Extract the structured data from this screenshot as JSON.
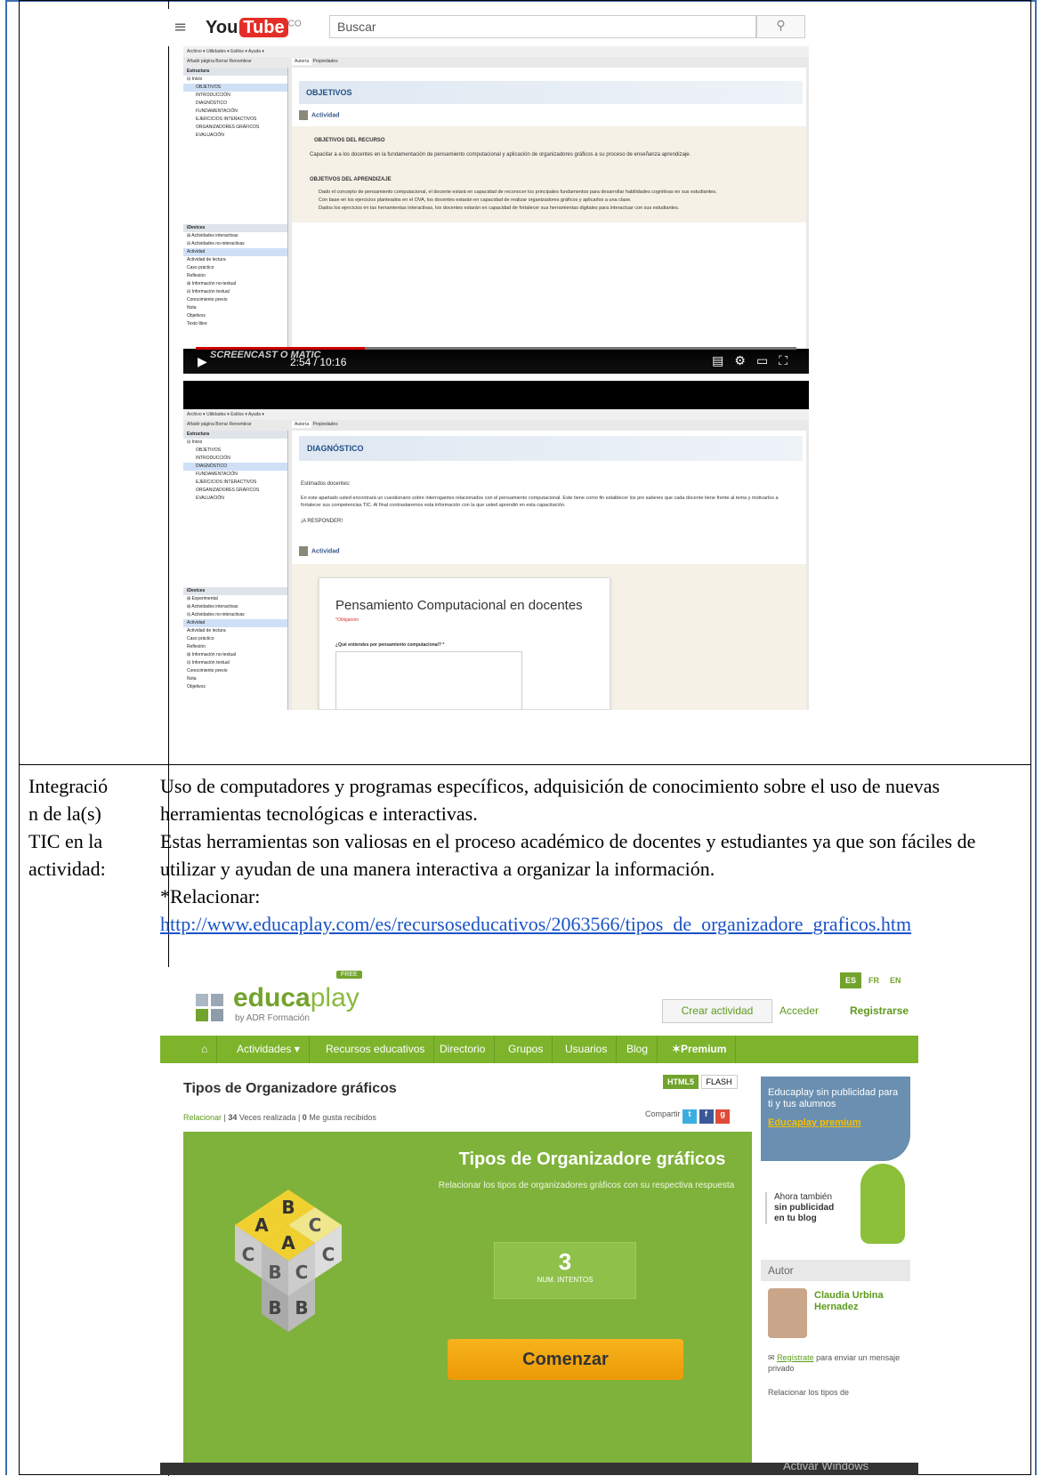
{
  "youtube": {
    "logo_you": "You",
    "logo_tube": "Tube",
    "logo_region": "CO",
    "search_placeholder": "Buscar",
    "time": "2:54 / 10:16",
    "watermark": "SCREENCAST O MATIC"
  },
  "video1": {
    "menu": "Archivo ▾  Utilidades ▾  Estilos ▾  Ayuda ▾",
    "toolbar": "Añadir página  Borrar  Renombrar",
    "tabs": [
      "Autoría",
      "Propiedades"
    ],
    "structure_header": "Estructura",
    "tree": [
      "⊟ Inicio",
      "OBJETIVOS",
      "INTRODUCCIÓN",
      "DIAGNÓSTICO",
      "FUNDAMENTACIÓN",
      "EJERCICIOS INTERACTIVOS",
      "ORGANIZADORES GRÁFICOS",
      "EVALUACIÓN"
    ],
    "idevices_header": "iDevices",
    "idevices": [
      "⊞ Actividades interactivas",
      "⊟ Actividades no-interactivas",
      "Actividad",
      "Actividad de lectura",
      "Caso práctico",
      "Reflexión",
      "⊞ Información no-textual",
      "⊟ Información textual",
      "Conocimiento previo",
      "Nota",
      "Objetivos",
      "Texto libre"
    ],
    "banner": "OBJETIVOS",
    "activity": "Actividad",
    "h1": "OBJETIVOS DEL RECURSO",
    "p1": "Capacitar a a los docentes en la fundamentación de pensamiento computacional y aplicación de organizadores gráficos a su proceso de enseñanza aprendizaje.",
    "h2": "OBJETIVOS DEL APRENDIZAJE",
    "bullets": [
      "Dado el concepto de pensamiento computacional, el docente estará en capacidad de reconocer los principales fundamentos para desarrollar habilidades cognitivas en sus estudiantes.",
      "Con base en los ejercicios planteados en el OVA, los docentes estarán en capacidad de realizar organizadores gráficos y aplicarlos a una clase.",
      "Dados los ejercicios en las herramientas interactivas, los docentes estarán en capacidad de fortalecer sus herramientas digitales para interactuar con sus estudiantes."
    ]
  },
  "video2": {
    "banner": "DIAGNÓSTICO",
    "greeting": "Estimados docentes:",
    "p1": "En este apartado usted encontrará un cuestionario sobre interrogantes relacionados con el pensamiento computacional. Este tiene como fin establecer los pre saberes que cada docente tiene frente al tema y motivarlos a fortalecer sus competencias TIC. Al final contrastaremos esta información con la que usted aprendió en esta capacitación.",
    "cta": "¡A RESPONDER!",
    "activity": "Actividad",
    "form_title": "Pensamiento Computacional en docentes",
    "form_required": "*Obligatorio",
    "form_question": "¿Qué entiendes por pensamiento computacional? *",
    "idevices": [
      "⊞ Experimental",
      "⊞ Actividades interactivas",
      "⊟ Actividades no-interactivas",
      "Actividad",
      "Actividad de lectura",
      "Caso práctico",
      "Reflexión",
      "⊞ Información no-textual",
      "⊟ Información textual",
      "Conocimiento previo",
      "Nota",
      "Objetivos"
    ]
  },
  "row2": {
    "label": "Integración de la(s) TIC en la actividad:",
    "label_lines": [
      "Integració",
      "n de la(s)",
      "TIC en la",
      "actividad:"
    ],
    "p1": "Uso de computadores y programas específicos, adquisición de conocimiento sobre el uso de nuevas herramientas tecnológicas e interactivas.",
    "p2": "Estas herramientas son valiosas en el proceso académico de docentes y estudiantes ya que son fáciles de utilizar y ayudan de una manera interactiva a organizar la información.",
    "p3": "*Relacionar:",
    "link": "http://www.educaplay.com/es/recursoseducativos/2063566/tipos_de_organizadore_graficos.htm"
  },
  "educaplay": {
    "brand_educa": "educa",
    "brand_play": "play",
    "free": "FREE",
    "by": "by ADR Formación",
    "langs": [
      "ES",
      "FR",
      "EN"
    ],
    "crear": "Crear actividad",
    "acceder": "Acceder",
    "registrarse": "Registrarse",
    "nav": [
      "Actividades ▾",
      "Recursos educativos",
      "Directorio",
      "Grupos",
      "Usuarios",
      "Blog",
      "✶Premium"
    ],
    "title": "Tipos de Organizadore gráficos",
    "tab_html5": "HTML5",
    "tab_flash": "FLASH",
    "meta_type": "Relacionar",
    "meta_count": "34",
    "meta_count_label": "Veces realizada",
    "meta_likes": "0",
    "meta_likes_label": "Me gusta recibidos",
    "share": "Compartir",
    "green_title": "Tipos de Organizadore gráficos",
    "green_sub": "Relacionar los tipos de organizadores gráficos con su respectiva respuesta",
    "attempts": "3",
    "attempts_label": "NUM. INTENTOS",
    "start": "Comenzar",
    "ad_text": "Educaplay sin publicidad para ti y tus alumnos",
    "ad_premium": "Educaplay premium",
    "blog_text1": "Ahora también",
    "blog_text2": "sin publicidad",
    "blog_text3": "en tu blog",
    "autor": "Autor",
    "author_name": "Claudia Urbina Hernadez",
    "register_link": "Regístrate",
    "register_rest": "para enviar un mensaje privado",
    "related": "Relacionar los tipos de",
    "windows": "Activar Windows"
  }
}
